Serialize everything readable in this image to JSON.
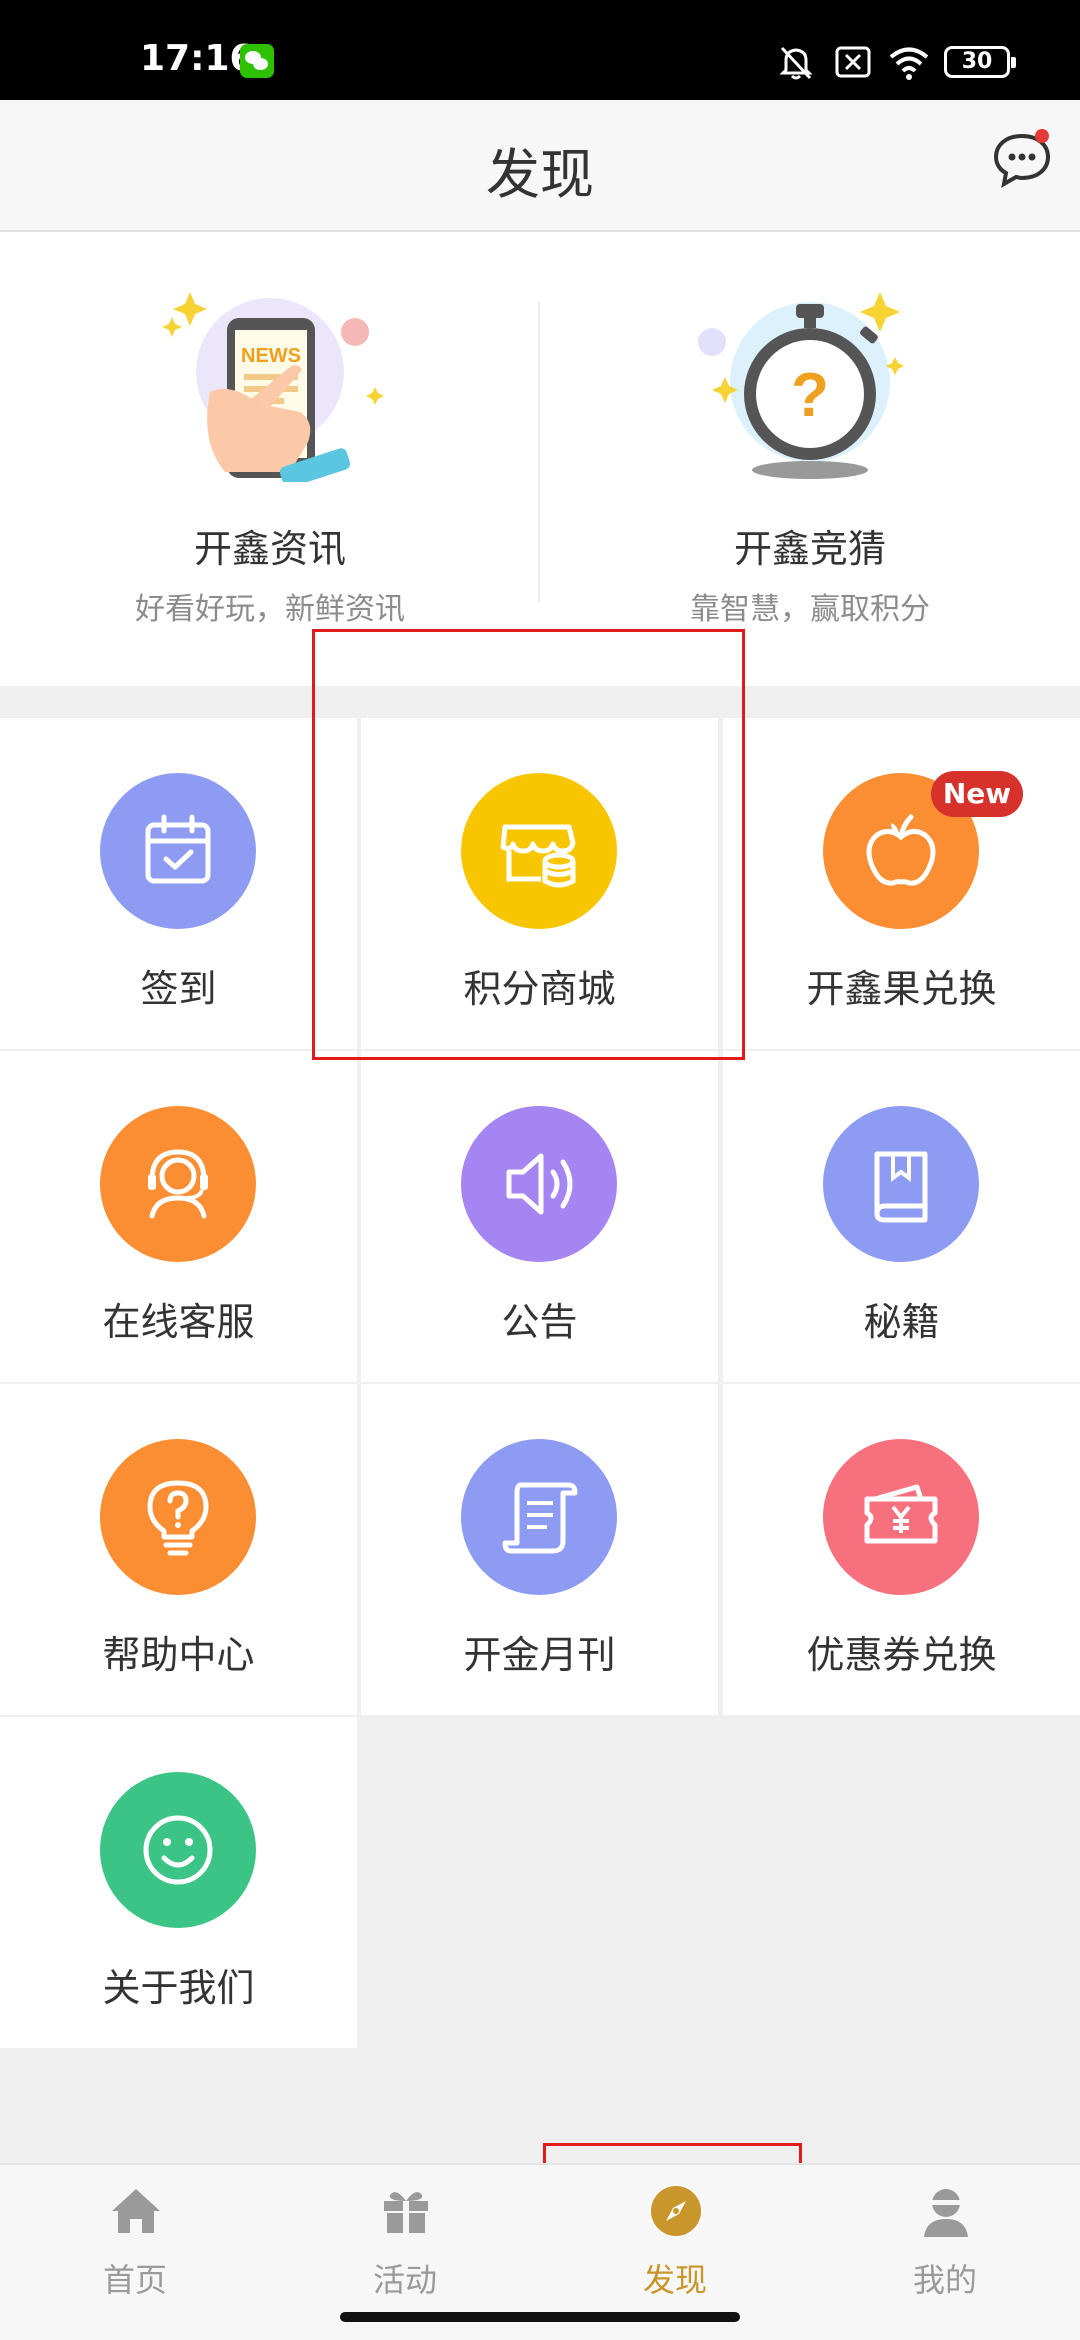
{
  "status_bar": {
    "time": "17:16",
    "battery": "30",
    "icons": [
      "wechat-icon",
      "bell-off-icon",
      "no-sim-icon",
      "wifi-icon",
      "battery-icon"
    ]
  },
  "header": {
    "title": "发现",
    "message_icon": "message-icon"
  },
  "featured": [
    {
      "title": "开鑫资讯",
      "subtitle": "好看好玩，新鲜资讯",
      "image_text": "NEWS",
      "icon": "news-phone-icon"
    },
    {
      "title": "开鑫竞猜",
      "subtitle": "靠智慧，赢取积分",
      "image_text": "?",
      "icon": "stopwatch-icon"
    }
  ],
  "grid": [
    {
      "label": "签到",
      "icon": "calendar-check-icon",
      "color": "#8e9bf3"
    },
    {
      "label": "积分商城",
      "icon": "store-coins-icon",
      "color": "#f7c600"
    },
    {
      "label": "开鑫果兑换",
      "icon": "apple-icon",
      "color": "#fb8d32",
      "badge": "New"
    },
    {
      "label": "在线客服",
      "icon": "headset-icon",
      "color": "#fb8d32"
    },
    {
      "label": "公告",
      "icon": "speaker-icon",
      "color": "#a585f1"
    },
    {
      "label": "秘籍",
      "icon": "book-icon",
      "color": "#8e9bf3"
    },
    {
      "label": "帮助中心",
      "icon": "lightbulb-question-icon",
      "color": "#fb8d32"
    },
    {
      "label": "开金月刊",
      "icon": "scroll-icon",
      "color": "#8e9bf3"
    },
    {
      "label": "优惠券兑换",
      "icon": "coupon-yuan-icon",
      "color": "#f7707d"
    },
    {
      "label": "关于我们",
      "icon": "smiley-icon",
      "color": "#3cc486"
    }
  ],
  "tabbar": {
    "tabs": [
      {
        "label": "首页",
        "icon": "home-icon",
        "active": false
      },
      {
        "label": "活动",
        "icon": "gift-icon",
        "active": false
      },
      {
        "label": "发现",
        "icon": "compass-icon",
        "active": true
      },
      {
        "label": "我的",
        "icon": "user-icon",
        "active": false
      }
    ],
    "active_color": "#c9962b",
    "inactive_color": "#9a9a9a"
  }
}
